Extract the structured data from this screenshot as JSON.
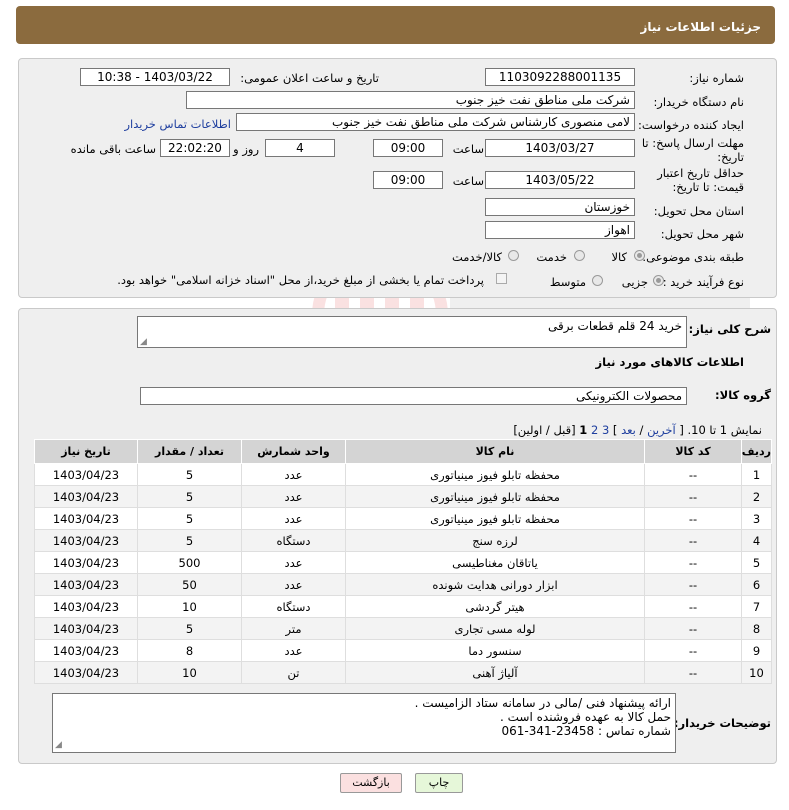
{
  "header": {
    "title": "جزئیات اطلاعات نیاز"
  },
  "form": {
    "need_number_label": "شماره نیاز:",
    "need_number": "1103092288001135",
    "announce_label": "تاریخ و ساعت اعلان عمومی:",
    "announce_value": "1403/03/22 - 10:38",
    "buyer_label": "نام دستگاه خریدار:",
    "buyer_value": "شرکت ملی مناطق نفت خیز جنوب",
    "creator_label": "ایجاد کننده درخواست:",
    "creator_value": "لامی منصوری کارشناس شرکت ملی مناطق نفت خیز جنوب",
    "contact_link": "اطلاعات تماس خریدار",
    "deadline_label": "مهلت ارسال پاسخ: تا تاریخ:",
    "deadline_date": "1403/03/27",
    "time_label": "ساعت",
    "deadline_time": "09:00",
    "days_value": "4",
    "days_label": "روز و",
    "remaining_time": "22:02:20",
    "remaining_label": "ساعت باقی مانده",
    "validity_label": "حداقل تاریخ اعتبار قیمت: تا تاریخ:",
    "validity_date": "1403/05/22",
    "validity_time": "09:00",
    "province_label": "استان محل تحویل:",
    "province_value": "خوزستان",
    "city_label": "شهر محل تحویل:",
    "city_value": "اهواز",
    "category_label": "طبقه بندی موضوعی:",
    "category_options": [
      "کالا",
      "خدمت",
      "کالا/خدمت"
    ],
    "process_label": "نوع فرآیند خرید :",
    "process_options": [
      "جزیی",
      "متوسط"
    ],
    "payment_text": "پرداخت تمام یا بخشی از مبلغ خرید،از محل \"اسناد خزانه اسلامی\" خواهد بود."
  },
  "summary": {
    "desc_label": "شرح کلی نیاز:",
    "desc_value": "خرید 24 قلم قطعات برقی",
    "goods_info_title": "اطلاعات کالاهای مورد نیاز",
    "group_label": "گروه کالا:",
    "group_value": "محصولات الکترونیکی"
  },
  "pagination": {
    "show": "نمایش 1 تا 10. [",
    "last": "آخرین",
    "sep": " / ",
    "next": "بعد",
    "close": "]",
    "p3": "3",
    "p2": "2",
    "p1": "1",
    "tail": "[قبل / اولین]"
  },
  "table": {
    "headers": [
      "ردیف",
      "کد کالا",
      "نام کالا",
      "واحد شمارش",
      "تعداد / مقدار",
      "تاریخ نیاز"
    ],
    "rows": [
      [
        "1",
        "--",
        "محفظه تابلو فیوز مینیاتوری",
        "عدد",
        "5",
        "1403/04/23"
      ],
      [
        "2",
        "--",
        "محفظه تابلو فیوز مینیاتوری",
        "عدد",
        "5",
        "1403/04/23"
      ],
      [
        "3",
        "--",
        "محفظه تابلو فیوز مینیاتوری",
        "عدد",
        "5",
        "1403/04/23"
      ],
      [
        "4",
        "--",
        "لرزه سنج",
        "دستگاه",
        "5",
        "1403/04/23"
      ],
      [
        "5",
        "--",
        "یاتاقان مغناطیسی",
        "عدد",
        "500",
        "1403/04/23"
      ],
      [
        "6",
        "--",
        "ابزار دورانی هدایت شونده",
        "عدد",
        "50",
        "1403/04/23"
      ],
      [
        "7",
        "--",
        "هیتر گردشی",
        "دستگاه",
        "10",
        "1403/04/23"
      ],
      [
        "8",
        "--",
        "لوله مسی تجاری",
        "متر",
        "5",
        "1403/04/23"
      ],
      [
        "9",
        "--",
        "سنسور دما",
        "عدد",
        "8",
        "1403/04/23"
      ],
      [
        "10",
        "--",
        "آلیاژ آهنی",
        "تن",
        "10",
        "1403/04/23"
      ]
    ]
  },
  "buyer_notes": {
    "label": "توضیحات خریدار:",
    "lines": [
      "ارائه پیشنهاد فنی /مالی در سامانه ستاد الزامیست .",
      "حمل کالا به عهده فروشنده است .",
      "شماره تماس : 23458-341-061"
    ]
  },
  "buttons": {
    "print": "چاپ",
    "back": "بازگشت"
  },
  "colors": {
    "header_bg": "#8b6b3e",
    "print_bg": "#e6f7d9",
    "back_bg": "#fbe0e0"
  }
}
